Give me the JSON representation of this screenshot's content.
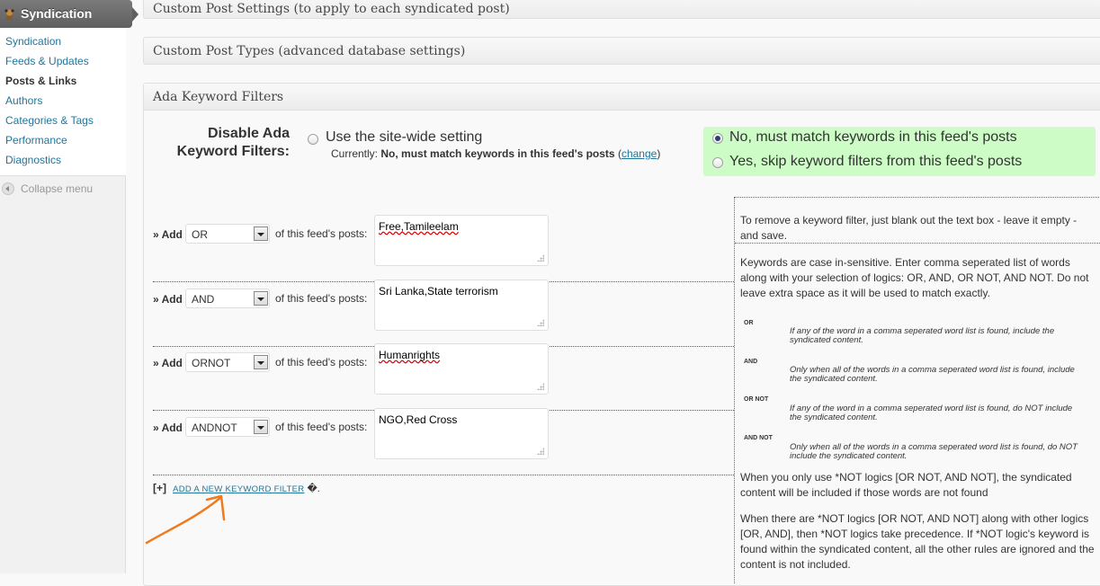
{
  "sidebar": {
    "title": "Syndication",
    "items": [
      {
        "label": "Syndication",
        "current": false
      },
      {
        "label": "Feeds & Updates",
        "current": false
      },
      {
        "label": "Posts & Links",
        "current": true
      },
      {
        "label": "Authors",
        "current": false
      },
      {
        "label": "Categories & Tags",
        "current": false
      },
      {
        "label": "Performance",
        "current": false
      },
      {
        "label": "Diagnostics",
        "current": false
      }
    ],
    "collapse_label": "Collapse menu"
  },
  "boxes": {
    "custom_post_settings": "Custom Post Settings (to apply to each syndicated post)",
    "custom_post_types": "Custom Post Types (advanced database settings)",
    "ada_keyword_filters": "Ada Keyword Filters"
  },
  "disable": {
    "label_line1": "Disable Ada",
    "label_line2": "Keyword Filters:",
    "site_wide_label": "Use the site-wide setting",
    "currently_prefix": "Currently:",
    "currently_value": "No, must match keywords in this feed's posts",
    "change_open": "(",
    "change_link": "change",
    "change_close": ")",
    "opt_no": "No, must match keywords in this feed's posts",
    "opt_yes": "Yes, skip keyword filters from this feed's posts",
    "selected": "no",
    "highlight_color": "#cdfcc6"
  },
  "filters": {
    "add_label": "» Add",
    "of_label": "of this feed's posts:",
    "rows": [
      {
        "logic": "OR",
        "keywords": "Free,Tamileelam"
      },
      {
        "logic": "AND",
        "keywords": "Sri Lanka,State terrorism"
      },
      {
        "logic": "ORNOT",
        "keywords": "Humanrights"
      },
      {
        "logic": "ANDNOT",
        "keywords": "NGO,Red Cross"
      }
    ],
    "add_new_plus": "[+]",
    "add_new_link": "ADD A NEW KEYWORD FILTER",
    "add_new_suffix": "�."
  },
  "help": {
    "remove_note": "To remove a keyword filter, just blank out the text box - leave it empty - and save.",
    "keywords_note": "Keywords are case in-sensitive. Enter comma seperated list of words along with your selection of logics: OR, AND, OR NOT, AND NOT. Do not leave extra space as it will be used to match exactly.",
    "logics": [
      {
        "name": "OR",
        "desc": "If any of the word in a comma seperated word list is found, include the syndicated content."
      },
      {
        "name": "AND",
        "desc": "Only when all of the words in a comma seperated word list is found, include the syndicated content."
      },
      {
        "name": "OR NOT",
        "desc": "If any of the word in a comma seperated word list is found, do NOT include the syndicated content."
      },
      {
        "name": "AND NOT",
        "desc": "Only when all of the words in a comma seperated word list is found, do NOT include the syndicated content."
      }
    ],
    "not_only_note": "When you only use *NOT logics [OR NOT, AND NOT], the syndicated content will be included if those words are not found",
    "precedence_note": "When there are *NOT logics [OR NOT, AND NOT] along with other logics [OR, AND], then *NOT logics take precedence. If *NOT logic's keyword is found within the syndicated content, all the other rules are ignored and the content is not included."
  },
  "colors": {
    "link": "#21759b",
    "annotation": "#f07a1e"
  }
}
